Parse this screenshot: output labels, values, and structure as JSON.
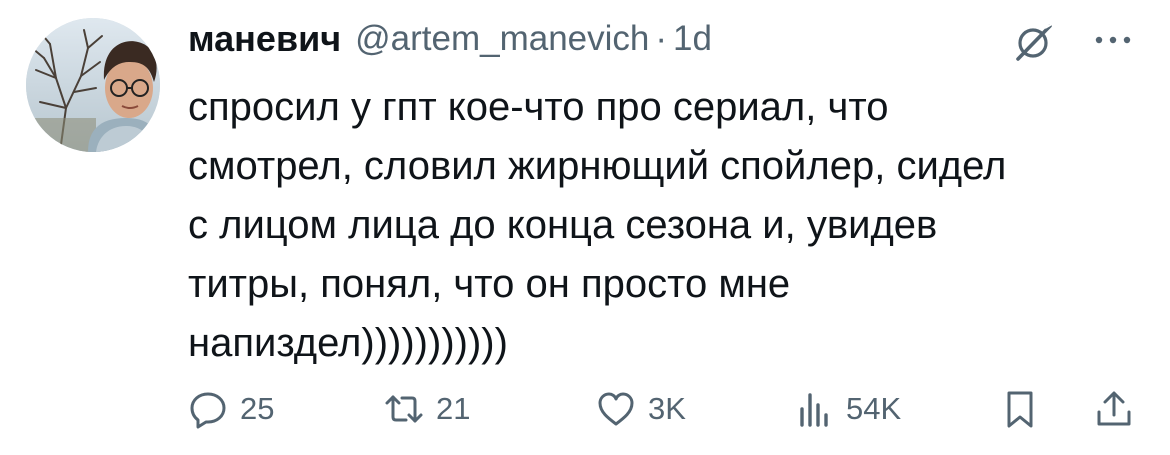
{
  "tweet": {
    "display_name": "маневич",
    "handle": "@artem_manevich",
    "separator": "·",
    "time": "1d",
    "text": "спросил у гпт кое-что про сериал, что\nсмотрел, словил жирнющий спойлер, сидел\nс лицом лица до конца сезона и, увидев\nтитры, понял, что он просто мне\nнапиздел)))))))))))"
  },
  "actions": {
    "replies": "25",
    "retweets": "21",
    "likes": "3K",
    "views": "54K"
  },
  "icons": {
    "reply": "reply-icon",
    "retweet": "retweet-icon",
    "like": "heart-icon",
    "views": "analytics-icon",
    "bookmark": "bookmark-icon",
    "share": "share-icon",
    "grok": "grok-icon",
    "more": "more-dots-icon"
  },
  "colors": {
    "text": "#0f1419",
    "secondary": "#536471",
    "background": "#ffffff"
  }
}
